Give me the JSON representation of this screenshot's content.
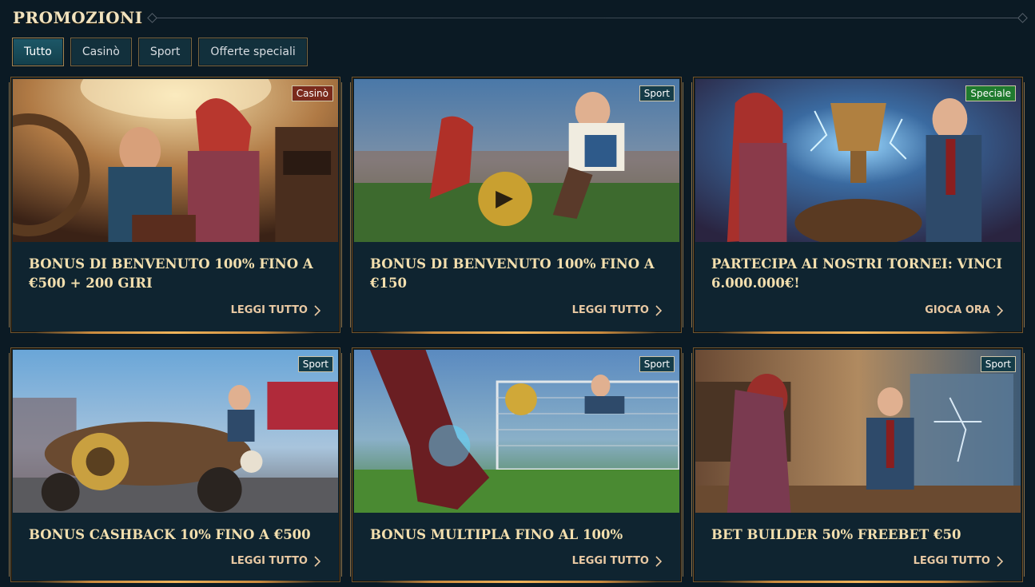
{
  "header": {
    "title": "PROMOZIONI"
  },
  "tabs": [
    {
      "label": "Tutto",
      "active": true
    },
    {
      "label": "Casinò",
      "active": false
    },
    {
      "label": "Sport",
      "active": false
    },
    {
      "label": "Offerte speciali",
      "active": false
    }
  ],
  "cards": [
    {
      "badge": "Casinò",
      "badge_type": "casino",
      "title": "BONUS DI BENVENUTO 100% FINO A €500 + 200 GIRI",
      "link": "LEGGI TUTTO",
      "image": "casino-steampunk-illustration"
    },
    {
      "badge": "Sport",
      "badge_type": "sport",
      "title": "BONUS DI BENVENUTO 100% FINO A €150",
      "link": "LEGGI TUTTO",
      "image": "football-stadium-illustration"
    },
    {
      "badge": "Speciale",
      "badge_type": "special",
      "title": "PARTECIPA AI NOSTRI TORNEI: VINCI 6.000.000€!",
      "link": "GIOCA ORA",
      "image": "trophy-lightning-illustration"
    },
    {
      "badge": "Sport",
      "badge_type": "sport",
      "title": "BONUS CASHBACK 10% FINO A €500",
      "link": "LEGGI TUTTO",
      "image": "race-car-illustration"
    },
    {
      "badge": "Sport",
      "badge_type": "sport",
      "title": "BONUS MULTIPLA FINO AL 100%",
      "link": "LEGGI TUTTO",
      "image": "kick-goal-illustration"
    },
    {
      "badge": "Sport",
      "badge_type": "sport",
      "title": "BET BUILDER 50% FREEBET €50",
      "link": "LEGGI TUTTO",
      "image": "workshop-blueprint-illustration"
    }
  ],
  "colors": {
    "background": "#0b1a24",
    "card_body": "#0f2430",
    "title_text": "#f3dfae",
    "border_gold": "#6f5632",
    "badge_casino": "#7a2a1c",
    "badge_sport": "#153c48",
    "badge_special": "#1f7a2e"
  }
}
